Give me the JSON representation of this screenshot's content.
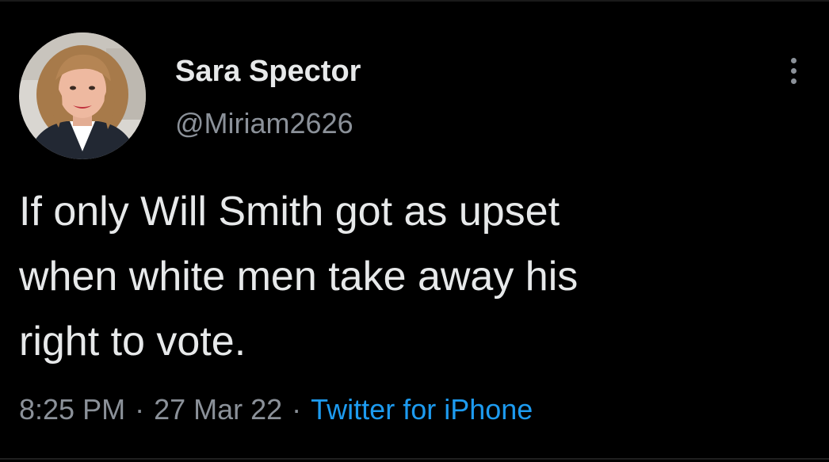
{
  "tweet": {
    "author": {
      "display_name": "Sara Spector",
      "handle": "@Miriam2626"
    },
    "text_lines": [
      "If only Will Smith got as upset",
      "when white men take away his",
      "right to vote."
    ],
    "time": "8:25 PM",
    "separator": "·",
    "date": "27 Mar 22",
    "source": "Twitter for iPhone"
  },
  "icons": {
    "more": "more-vertical-icon"
  },
  "colors": {
    "background": "#000000",
    "primary_text": "#e7e9ea",
    "secondary_text": "#8b9199",
    "link": "#1d9bf0"
  }
}
